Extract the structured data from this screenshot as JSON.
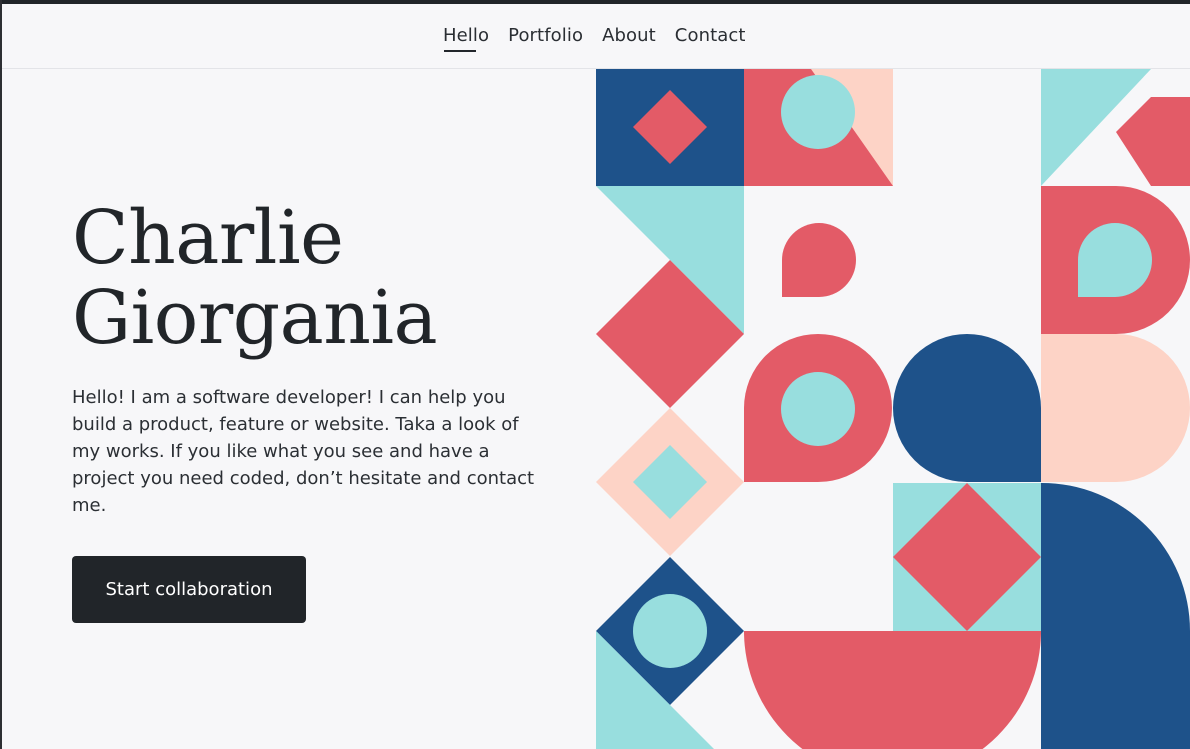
{
  "nav": {
    "items": [
      {
        "label": "Hello"
      },
      {
        "label": "Portfolio"
      },
      {
        "label": "About"
      },
      {
        "label": "Contact"
      }
    ]
  },
  "hero": {
    "title_line1": "Charlie",
    "title_line2": "Giorgania",
    "intro": "Hello! I am a software developer! I can help you build a product, feature or website. Taka a look of my works. If you like what you see and have a project you need coded, don’t hesitate and contact me.",
    "cta_label": "Start collaboration"
  },
  "colors": {
    "navy": "#1e528a",
    "coral": "#e35b67",
    "aqua": "#98dede",
    "peach": "#fdd3c6",
    "dark": "#212529"
  }
}
